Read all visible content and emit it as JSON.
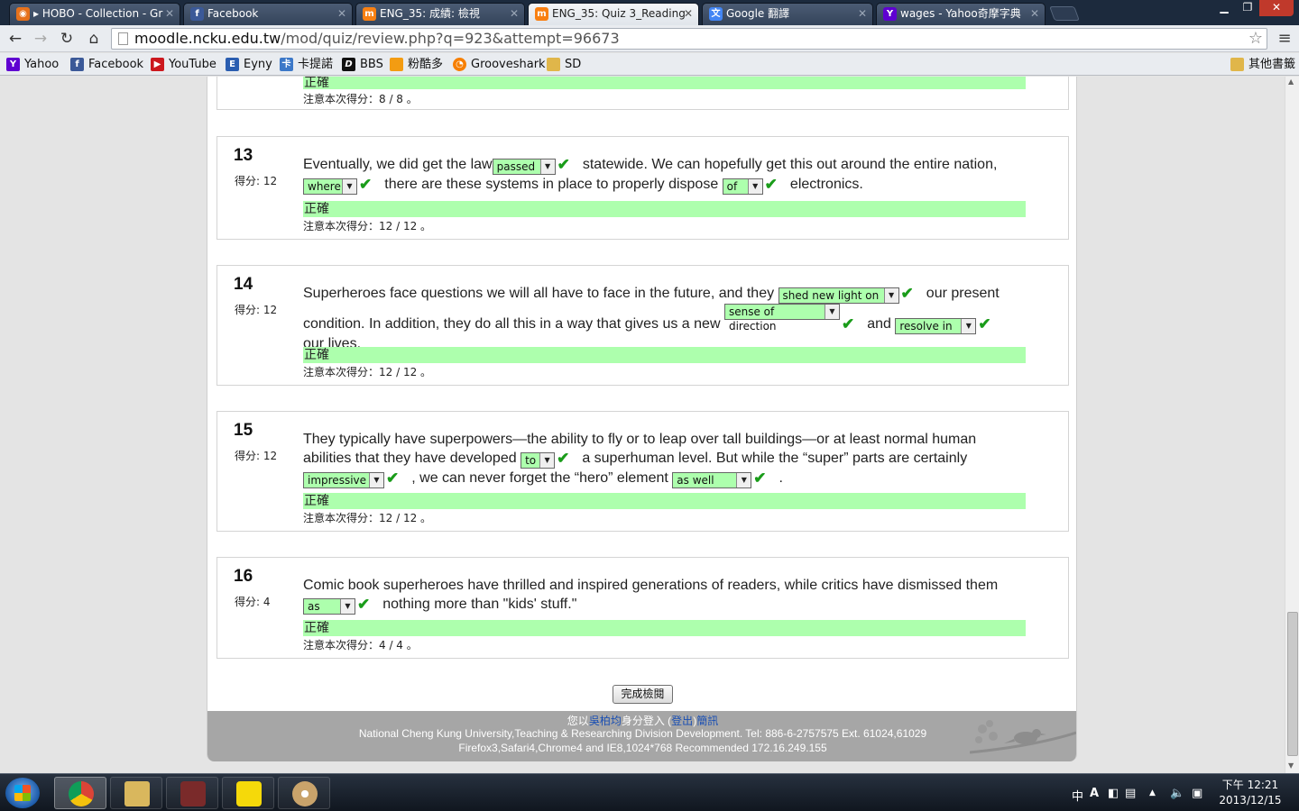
{
  "browser": {
    "tabs": [
      {
        "title": "▸ HOBO - Collection - Gr",
        "icon": "hobo-icon",
        "color": "#e6711b"
      },
      {
        "title": "Facebook",
        "icon": "facebook-icon",
        "color": "#3b5998"
      },
      {
        "title": "ENG_35: 成績: 檢視",
        "icon": "moodle-icon",
        "color": "#f98012"
      },
      {
        "title": "ENG_35: Quiz 3_Reading",
        "icon": "moodle-icon",
        "color": "#f98012",
        "active": true
      },
      {
        "title": "Google 翻譯",
        "icon": "google-translate-icon",
        "color": "#4285f4"
      },
      {
        "title": "wages - Yahoo奇摩字典",
        "icon": "yahoo-icon",
        "color": "#5f01d1"
      }
    ],
    "url_host": "moodle.ncku.edu.tw",
    "url_path": "/mod/quiz/review.php?q=923&attempt=96673",
    "bookmarks": [
      {
        "label": "Yahoo",
        "icon": "yahoo-icon",
        "color": "#5f01d1"
      },
      {
        "label": "Facebook",
        "icon": "facebook-icon",
        "color": "#3b5998"
      },
      {
        "label": "YouTube",
        "icon": "youtube-icon",
        "color": "#cc181e"
      },
      {
        "label": "Eyny",
        "icon": "eyny-icon",
        "color": "#2a5db0"
      },
      {
        "label": "卡提諾",
        "icon": "ck101-icon",
        "color": "#3c78c8"
      },
      {
        "label": "BBS",
        "icon": "bbs-icon",
        "color": "#111111"
      },
      {
        "label": "粉酷多",
        "icon": "fenkuduo-icon",
        "color": "#f39c12"
      },
      {
        "label": "Grooveshark",
        "icon": "grooveshark-icon",
        "color": "#f77f00"
      },
      {
        "label": "SD",
        "icon": "folder-icon",
        "color": "#e0b64a"
      }
    ],
    "other_bookmarks": "其他書籤"
  },
  "quiz": {
    "prev": {
      "correct_label": "正確",
      "score_note": "注意本次得分：8 / 8 。"
    },
    "questions": [
      {
        "number": "13",
        "mark": "得分: 12",
        "t1": "Eventually, we did get the law",
        "s1": "passed",
        "t2": "statewide. We can hopefully get this out around the entire nation,",
        "s2": "where",
        "t3": "there are these systems in place to properly dispose",
        "s3": "of",
        "t4": "electronics.",
        "correct_label": "正確",
        "score_note": "注意本次得分：12 / 12 。"
      },
      {
        "number": "14",
        "mark": "得分: 12",
        "t1": "Superheroes face questions we will all have to face in the future, and they",
        "s1": "shed new light on",
        "t2": "our present condition. In addition, they do all this in a way that gives us a new",
        "s2": "sense of direction",
        "t3": "and",
        "s3": "resolve in",
        "t4": "our lives.",
        "correct_label": "正確",
        "score_note": "注意本次得分：12 / 12 。"
      },
      {
        "number": "15",
        "mark": "得分: 12",
        "t1": "They typically have superpowers—the ability to fly or to leap over tall buildings—or at least normal human abilities that they have developed",
        "s1": "to",
        "t2": "a superhuman level. But while the “super” parts are certainly",
        "s2": "impressive",
        "t3": ", we can never forget the “hero” element",
        "s3": "as well",
        "t4": ".",
        "correct_label": "正確",
        "score_note": "注意本次得分：12 / 12 。"
      },
      {
        "number": "16",
        "mark": "得分: 4",
        "t1": "Comic book superheroes have thrilled and inspired generations of readers, while critics have dismissed them",
        "s1": "as",
        "t2": "nothing more than \"kids' stuff.\"",
        "correct_label": "正確",
        "score_note": "注意本次得分：4 / 4 。"
      }
    ],
    "finish_button": "完成檢閱"
  },
  "footer": {
    "login_prefix": "您以",
    "user_name": "吳柏均",
    "login_mid": "身分登入 (",
    "logout": "登出",
    "login_suffix": ")",
    "news": "簡訊",
    "line2": "National Cheng Kung University,Teaching & Researching Division Development. Tel: 886-6-2757575 Ext. 61024,61029",
    "line3": "Firefox3,Safari4,Chrome4 and IE8,1024*768 Recommended 172.16.249.155"
  },
  "taskbar": {
    "apps": [
      "chrome-icon",
      "explorer-icon",
      "game-icon",
      "kakao-icon",
      "paint-icon"
    ],
    "clock_time": "下午 12:21",
    "clock_date": "2013/12/15"
  },
  "colors": {
    "correct_bg": "#adffad",
    "tick": "#1a9c1a",
    "footer_bg": "#a6a6a6"
  }
}
